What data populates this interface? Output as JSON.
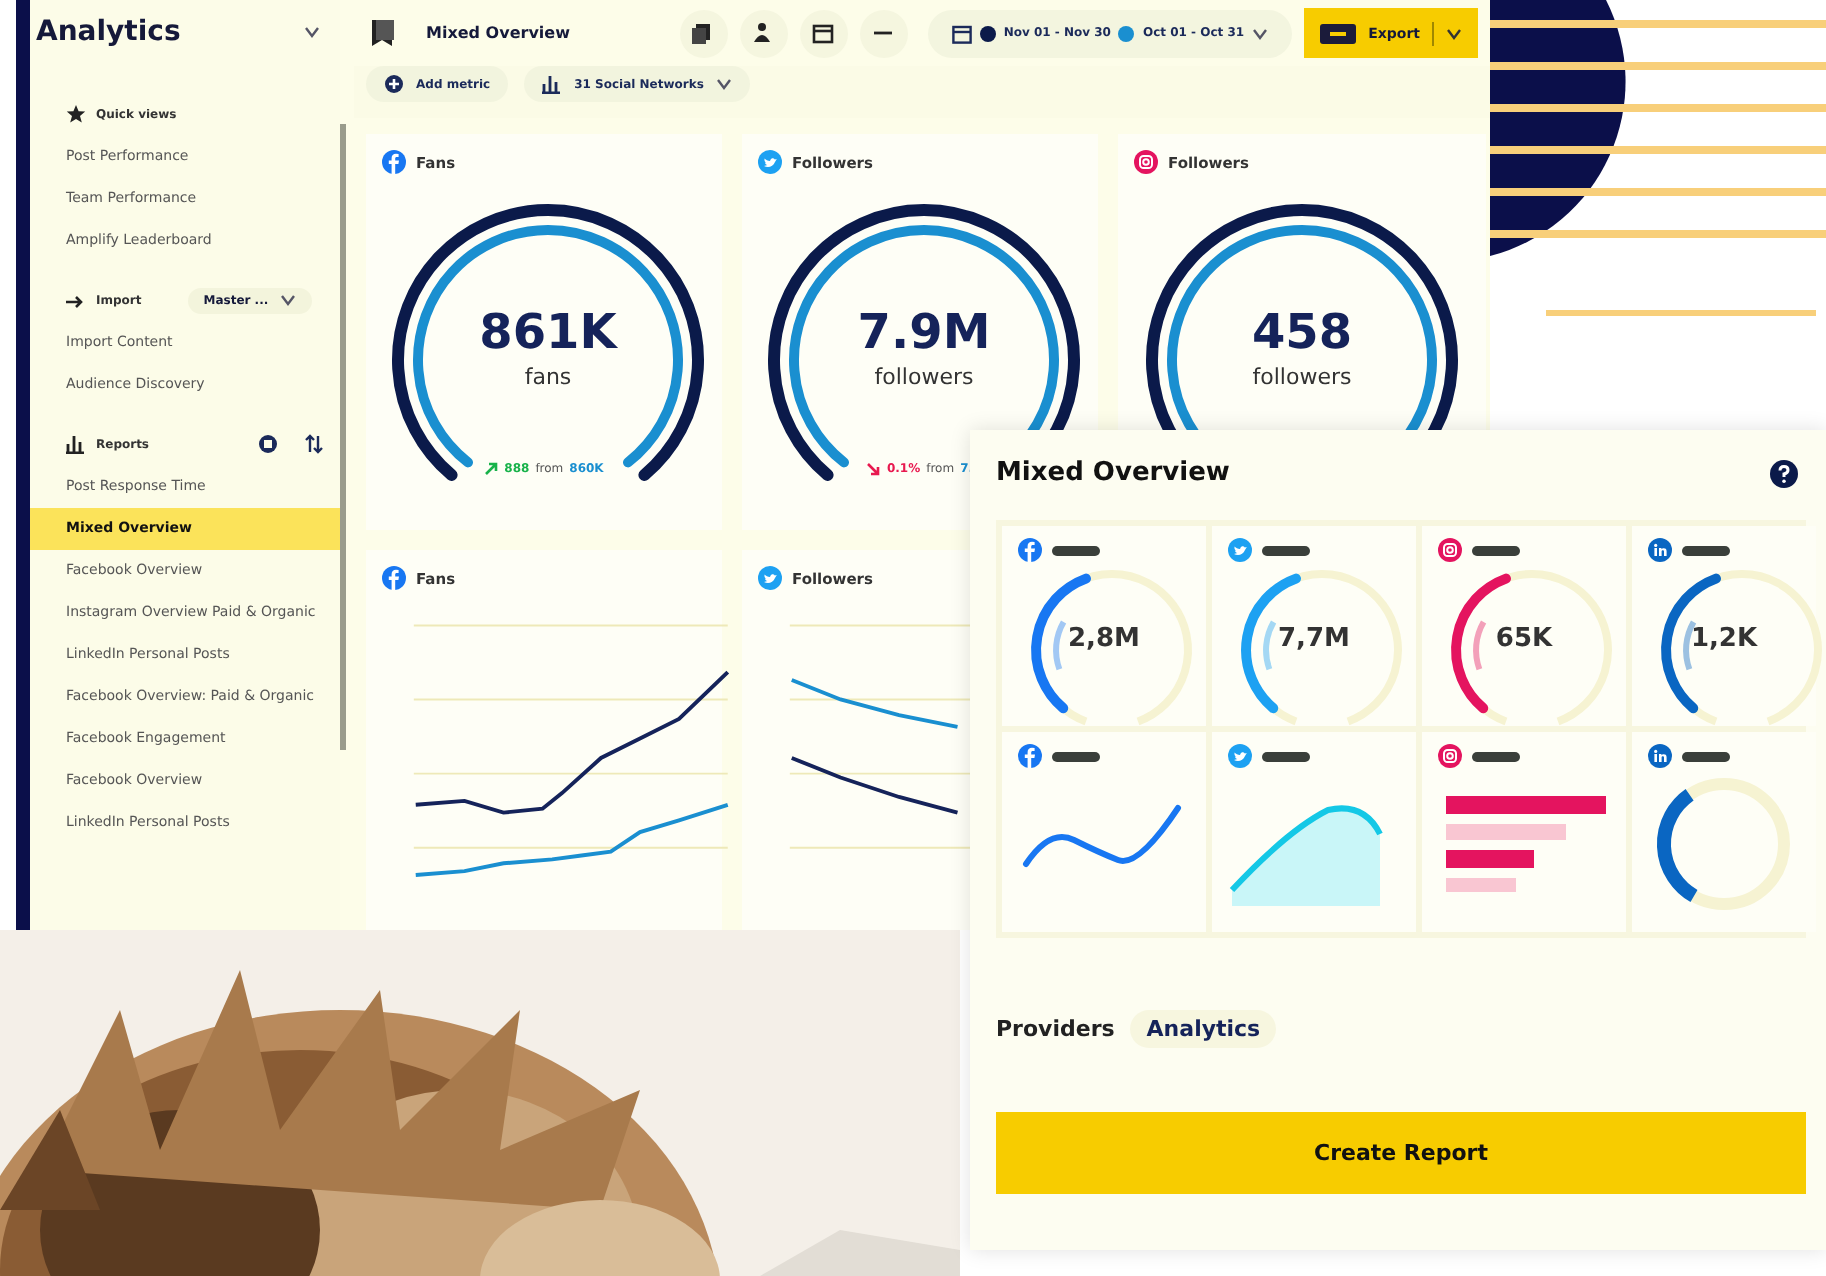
{
  "app_window": {
    "sidebar": {
      "title": "Analytics",
      "sections": [
        {
          "kind": "views",
          "heading": "Quick views",
          "items": [
            {
              "label": "Post Performance",
              "selected": false
            },
            {
              "label": "Team Performance",
              "selected": false
            },
            {
              "label": "Amplify Leaderboard",
              "selected": false
            }
          ]
        },
        {
          "kind": "import",
          "heading": "Import",
          "dropdown": "Master ...",
          "items": [
            {
              "label": "Import Content",
              "selected": false
            },
            {
              "label": "Audience Discovery",
              "selected": false
            }
          ]
        },
        {
          "kind": "reports",
          "heading": "Reports",
          "items": [
            {
              "label": "Post Response Time",
              "selected": false
            },
            {
              "label": "Mixed Overview",
              "selected": true
            },
            {
              "label": "Facebook Overview",
              "selected": false
            },
            {
              "label": "Instagram Overview Paid & Organic",
              "selected": false
            },
            {
              "label": "LinkedIn Personal Posts",
              "selected": false
            },
            {
              "label": "Facebook Overview: Paid & Organic",
              "selected": false
            },
            {
              "label": "Facebook Engagement",
              "selected": false
            },
            {
              "label": "Facebook Overview",
              "selected": false
            },
            {
              "label": "LinkedIn Personal Posts",
              "selected": false
            }
          ]
        }
      ]
    },
    "toolbar": {
      "title": "Mixed Overview",
      "date_range": "Nov 01 - Nov 30",
      "compare_range": "Oct 01 - Oct 31",
      "export_label": "Export"
    },
    "filters": [
      {
        "kind": "add",
        "label": "Add metric"
      },
      {
        "kind": "networks",
        "label": "31 Social Networks"
      }
    ],
    "gauge_cards": [
      {
        "kind": "facebook",
        "title": "Fans",
        "value": "861K",
        "unit": "fans",
        "change": "888",
        "rising": true,
        "from_text": "from",
        "baseline": "860K"
      },
      {
        "kind": "twitter",
        "title": "Followers",
        "value": "7.9M",
        "unit": "followers",
        "change": "0.1%",
        "rising": false,
        "from_text": "from",
        "baseline": "7."
      },
      {
        "kind": "instagram",
        "title": "Followers",
        "value": "458",
        "unit": "followers"
      }
    ],
    "chart_cards": [
      {
        "kind": "facebook",
        "title": "Fans"
      },
      {
        "kind": "twitter",
        "title": "Followers"
      }
    ]
  },
  "overview_card": {
    "title": "Mixed Overview",
    "tiles": [
      {
        "color": "#1877f2",
        "kind": "gauge",
        "value": "2,8M"
      },
      {
        "color": "#1da1f2",
        "kind": "gauge",
        "value": "7,7M"
      },
      {
        "color": "#e4145f",
        "kind": "gauge",
        "value": "65K"
      },
      {
        "color": "#0a66c2",
        "kind": "gauge",
        "value": "1,2K"
      },
      {
        "color": "#1877f2",
        "kind": "line"
      },
      {
        "color": "#1da1f2",
        "kind": "area"
      },
      {
        "color": "#e4145f",
        "kind": "bars"
      },
      {
        "color": "#0a66c2",
        "kind": "ring"
      }
    ],
    "providers_label": "Providers",
    "provider": "Analytics",
    "button": "Create Report"
  }
}
